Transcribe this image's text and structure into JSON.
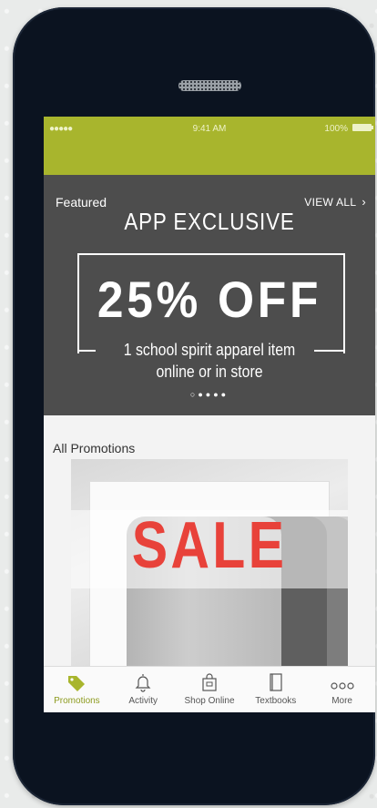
{
  "status_bar": {
    "signal": "●●●●●",
    "time": "9:41 AM",
    "battery": "100%"
  },
  "featured": {
    "label": "Featured",
    "view_all": "VIEW ALL",
    "chevron": "›",
    "promo": {
      "title": "APP EXCLUSIVE",
      "big": "25% OFF",
      "line1": "1 school spirit apparel item",
      "line2": "online or in store"
    },
    "carousel_dots": "○●●●●"
  },
  "all_promotions": {
    "title": "All Promotions",
    "sale_text": "SALE"
  },
  "tabbar": {
    "items": [
      {
        "label": "Promotions",
        "icon": "tag-icon"
      },
      {
        "label": "Activity",
        "icon": "bell-icon"
      },
      {
        "label": "Shop Online",
        "icon": "shopping-bag-icon"
      },
      {
        "label": "Textbooks",
        "icon": "book-icon"
      },
      {
        "label": "More",
        "icon": "more-icon"
      }
    ]
  },
  "colors": {
    "accent": "#a8b52d",
    "promo_bg": "#4d4d4d",
    "sale_red": "#e8423a"
  }
}
